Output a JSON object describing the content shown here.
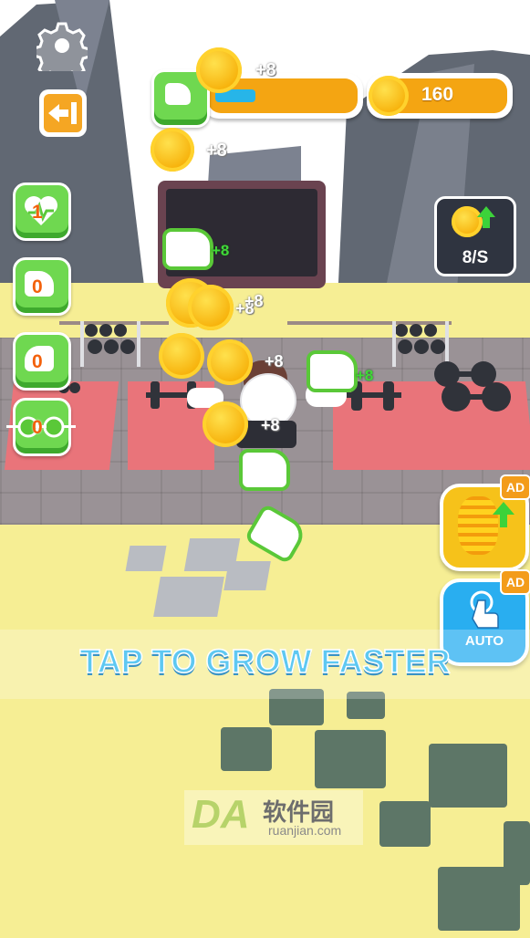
{
  "hud": {
    "muscle_bar_progress": 0.3,
    "coins": "160",
    "float_top": "+8",
    "float_mid": "+8"
  },
  "income": {
    "rate": "8/S"
  },
  "stats": [
    {
      "icon": "heart-pulse-icon",
      "value": "1"
    },
    {
      "icon": "bicep-icon",
      "value": "0"
    },
    {
      "icon": "arm-icon",
      "value": "0"
    },
    {
      "icon": "glasses-icon",
      "value": "0"
    }
  ],
  "floaters": {
    "a": "+8",
    "b": "+8",
    "c": "+8",
    "d": "+8",
    "e": "+8",
    "f": "+8",
    "g": "+8"
  },
  "buttons": {
    "ad_badge_1": "AD",
    "ad_badge_2": "AD",
    "auto_label": "AUTO"
  },
  "prompt": "TAP TO GROW FASTER",
  "watermark": {
    "brand": "DA",
    "cn": "软件园",
    "site": "ruanjian.com"
  },
  "colors": {
    "accent_green": "#6fd850",
    "bar_orange": "#f4a512",
    "prompt_blue": "#5ec8f2"
  }
}
